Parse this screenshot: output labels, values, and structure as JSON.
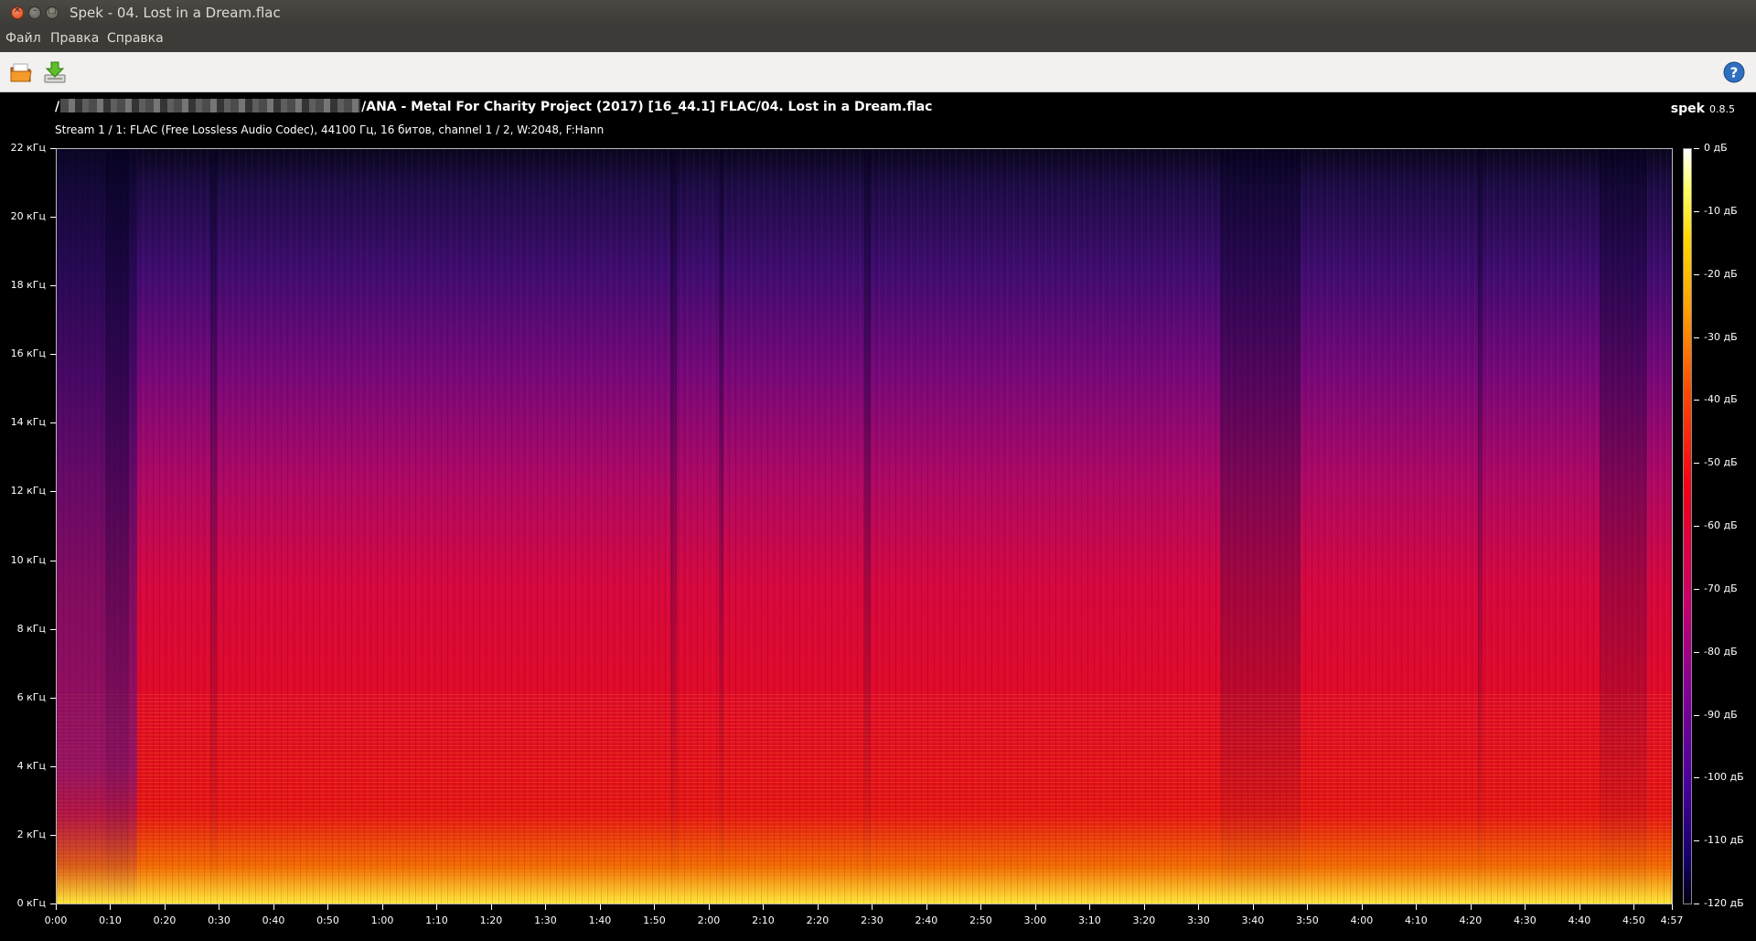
{
  "window": {
    "title": "Spek - 04. Lost in a Dream.flac"
  },
  "menu": [
    "Файл",
    "Правка",
    "Справка"
  ],
  "toolbar": {
    "open_icon": "open-file-icon",
    "save_icon": "save-icon",
    "help_icon": "help-icon",
    "help_glyph": "?"
  },
  "file": {
    "path_prefix": "/",
    "path_suffix": "/ANA - Metal For Charity Project (2017) [16_44.1] FLAC/04. Lost in a Dream.flac",
    "stream_info": "Stream 1 / 1: FLAC (Free Lossless Audio Codec), 44100 Гц, 16 битов, channel 1 / 2, W:2048, F:Hann"
  },
  "brand": {
    "name": "spek",
    "version": "0.8.5"
  },
  "chart_data": {
    "type": "heatmap",
    "y_ticks": [
      "22 кГц",
      "20 кГц",
      "18 кГц",
      "16 кГц",
      "14 кГц",
      "12 кГц",
      "10 кГц",
      "8 кГц",
      "6 кГц",
      "4 кГц",
      "2 кГц",
      "0 кГц"
    ],
    "ylim": [
      0,
      22
    ],
    "x_ticks": [
      "0:00",
      "0:10",
      "0:20",
      "0:30",
      "0:40",
      "0:50",
      "1:00",
      "1:10",
      "1:20",
      "1:30",
      "1:40",
      "1:50",
      "2:00",
      "2:10",
      "2:20",
      "2:30",
      "2:40",
      "2:50",
      "3:00",
      "3:10",
      "3:20",
      "3:30",
      "3:40",
      "3:50",
      "4:00",
      "4:10",
      "4:20",
      "4:30",
      "4:40",
      "4:50",
      "4:57"
    ],
    "x_tick_seconds": [
      0,
      10,
      20,
      30,
      40,
      50,
      60,
      70,
      80,
      90,
      100,
      110,
      120,
      130,
      140,
      150,
      160,
      170,
      180,
      190,
      200,
      210,
      220,
      230,
      240,
      250,
      260,
      270,
      280,
      290,
      297
    ],
    "duration_seconds": 297,
    "colorbar_ticks": [
      "0 дБ",
      "-10 дБ",
      "-20 дБ",
      "-30 дБ",
      "-40 дБ",
      "-50 дБ",
      "-60 дБ",
      "-70 дБ",
      "-80 дБ",
      "-90 дБ",
      "-100 дБ",
      "-110 дБ",
      "-120 дБ"
    ],
    "colorbar_range_db": [
      -120,
      0
    ]
  }
}
